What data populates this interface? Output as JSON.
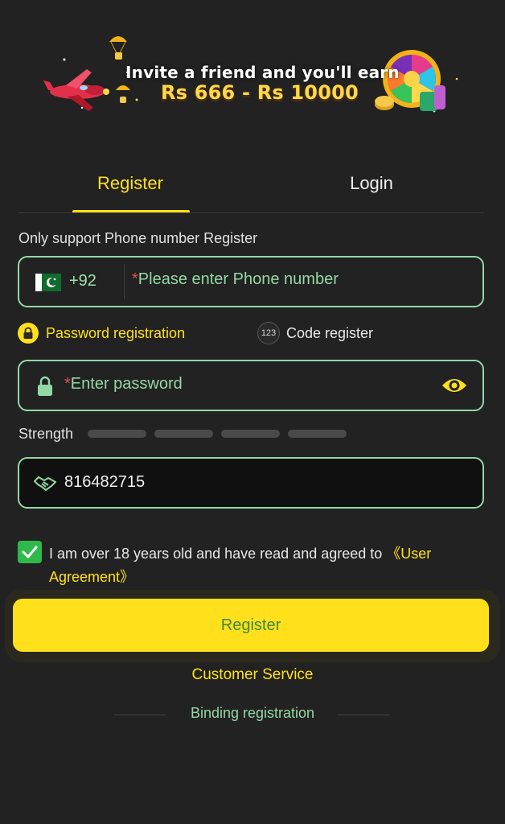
{
  "banner": {
    "line1": "Invite a friend and you'll earn",
    "line2": "Rs 666 - Rs 10000",
    "icons": [
      "airplane-icon",
      "parachute-icon",
      "spin-wheel-icon",
      "coin-stack-icon"
    ]
  },
  "tabs": [
    {
      "label": "Register",
      "active": true
    },
    {
      "label": "Login",
      "active": false
    }
  ],
  "hint": "Only support Phone number Register",
  "phone": {
    "country_code": "+92",
    "required_mark": "*",
    "placeholder": "Please enter Phone number",
    "flag": "pakistan-flag-icon"
  },
  "modes": {
    "password_label": "Password registration",
    "code_badge": "123",
    "code_label": "Code register"
  },
  "password": {
    "required_mark": "*",
    "placeholder": "Enter password"
  },
  "strength": {
    "label": "Strength",
    "segments": 4,
    "level": 0
  },
  "invite": {
    "value": "816482715"
  },
  "agreement": {
    "checked": true,
    "text": "I am over 18 years old and have read and agreed to ",
    "link": "《User Agreement》"
  },
  "register_button": "Register",
  "customer_service": "Customer Service",
  "binding_registration": "Binding registration",
  "colors": {
    "background": "#222222",
    "accent_yellow": "#ffe01a",
    "accent_green": "#93d8a4",
    "checkbox_green": "#2fb94b",
    "required_red": "#e05050"
  }
}
